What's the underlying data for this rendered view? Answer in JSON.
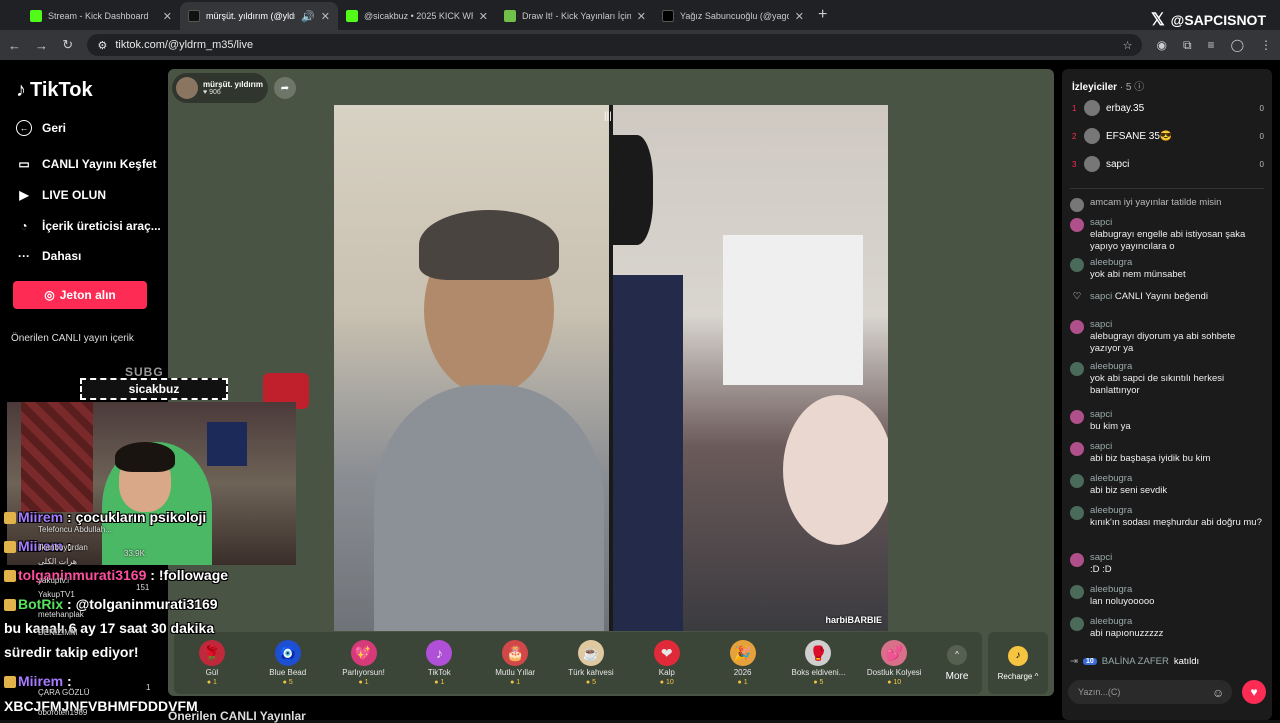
{
  "browser": {
    "tabs": [
      {
        "title": "Stream - Kick Dashboard",
        "fav_color": "#53fc18",
        "active": false
      },
      {
        "title": "mürşüt. yıldırım (@yldrm_m...",
        "fav_color": "#111111",
        "active": true
      },
      {
        "title": "@sicakbuz • 2025 KICK WRAPP...",
        "fav_color": "#53fc18",
        "active": false
      },
      {
        "title": "Draw It! - Kick Yayınları İçin Çizim...",
        "fav_color": "#6fbf4a",
        "active": false
      },
      {
        "title": "Yağız Sabuncuoğlu (@yagosab...",
        "fav_color": "#000000",
        "active": false
      }
    ],
    "new_tab": "+",
    "brand": "@SAPCISNOT",
    "url": "tiktok.com/@yldrm_m35/live"
  },
  "sidebar": {
    "logo": "TikTok",
    "items": [
      {
        "label": "Geri",
        "icon": "←"
      },
      {
        "label": "CANLI Yayını Keşfet",
        "icon": "▭"
      },
      {
        "label": "LIVE OLUN",
        "icon": "▶"
      },
      {
        "label": "İçerik üreticisi araç...",
        "icon": "◔"
      },
      {
        "label": "Dahası",
        "icon": "···"
      }
    ],
    "jeton_button": "Jeton alın",
    "suggested": "Önerilen CANLI yayın içerik"
  },
  "stream": {
    "host_name": "mürşüt. yıldırım",
    "host_likes": "906",
    "video_label": "harbiBARBIE",
    "bottom_title": "Önerilen CANLI Yayınlar"
  },
  "gifts": [
    {
      "name": "Gül",
      "cost": "1",
      "icon": "🌹",
      "color": "#c0283c"
    },
    {
      "name": "Blue Bead",
      "cost": "5",
      "icon": "🧿",
      "color": "#1f4fd1"
    },
    {
      "name": "Parlıyorsun!",
      "cost": "1",
      "icon": "💖",
      "color": "#d63a78"
    },
    {
      "name": "TikTok",
      "cost": "1",
      "icon": "♪",
      "color": "#b04fd8"
    },
    {
      "name": "Mutlu Yıllar",
      "cost": "1",
      "icon": "🎂",
      "color": "#d24848"
    },
    {
      "name": "Türk kahvesi",
      "cost": "5",
      "icon": "☕",
      "color": "#e0c9a0"
    },
    {
      "name": "Kalp",
      "cost": "10",
      "icon": "❤",
      "color": "#e02a3a"
    },
    {
      "name": "2026",
      "cost": "1",
      "icon": "🎉",
      "color": "#e6a23a"
    },
    {
      "name": "Boks eldiveni...",
      "cost": "5",
      "icon": "🥊",
      "color": "#cfcfcf"
    },
    {
      "name": "Dostluk Kolyesi",
      "cost": "10",
      "icon": "💕",
      "color": "#d8708a"
    }
  ],
  "gift_more": "More",
  "recharge": "Recharge ^",
  "chat": {
    "viewers_title": "İzleyiciler",
    "viewers_count": "· 5",
    "top_viewers": [
      {
        "rank": "1",
        "name": "erbay.35",
        "score": "0"
      },
      {
        "rank": "2",
        "name": "EFSANE 35😎",
        "score": "0"
      },
      {
        "rank": "3",
        "name": "sapci",
        "score": "0"
      }
    ],
    "messages": [
      {
        "user": "",
        "text": "amcam iyi yayınlar tatilde misin",
        "color": "#777777"
      },
      {
        "user": "sapci",
        "text": "elabugrayı engelle abi istiyosan şaka yapıyo yayıncılara o",
        "color": "#b0508a"
      },
      {
        "user": "aleebugra",
        "text": "yok abi nem münsabet",
        "color": "#4a6a5a"
      },
      {
        "user": "sapci",
        "text": "CANLI Yayını beğendi",
        "color": "#333333"
      },
      {
        "user": "sapci",
        "text": "alebugrayı diyorum ya abi sohbete yazıyor ya",
        "color": "#b0508a"
      },
      {
        "user": "aleebugra",
        "text": "yok abi sapci de sıkıntılı herkesi banlattınyor",
        "color": "#4a6a5a"
      },
      {
        "user": "sapci",
        "text": "bu kim ya",
        "color": "#b0508a"
      },
      {
        "user": "sapci",
        "text": "abi biz başbaşa iyidik bu kim",
        "color": "#b0508a"
      },
      {
        "user": "aleebugra",
        "text": "abi biz seni sevdik",
        "color": "#4a6a5a"
      },
      {
        "user": "aleebugra",
        "text": "kınık'ın sodası meşhurdur abi doğru mu?",
        "color": "#4a6a5a"
      },
      {
        "user": "sapci",
        "text": ":D :D",
        "color": "#b0508a"
      },
      {
        "user": "aleebugra",
        "text": "lan noluyooooo",
        "color": "#4a6a5a"
      },
      {
        "user": "aleebugra",
        "text": "abi napıonuzzzzz",
        "color": "#4a6a5a"
      }
    ],
    "join_level": "10",
    "join_user": "BALİNA ZAFER",
    "join_text": "katıldı",
    "input_placeholder": "Yazın...(C)"
  },
  "overlay": {
    "sub_label": "SUBG",
    "streamer_name": "sicakbuz",
    "chat_lines": [
      {
        "user": "Miirem",
        "text": ": çocukların psikoloji",
        "color": "#a77bff"
      },
      {
        "user": "Miirem",
        "text": ":",
        "color": "#a77bff"
      },
      {
        "user": "tolganinmurati3169",
        "text": ": !followage",
        "color": "#ff4fa0"
      },
      {
        "user": "BotRix",
        "text": ": @tolganinmurati3169",
        "color": "#57e35d"
      },
      {
        "user": "",
        "text": "bu kanalı 6 ay 17 saat 30 dakika",
        "color": "#ffffff"
      },
      {
        "user": "",
        "text": "süredir takip ediyor!",
        "color": "#ffffff"
      },
      {
        "user": "Miirem",
        "text": ":",
        "color": "#a77bff"
      },
      {
        "user": "",
        "text": "XBCJFMJNFVBHMFDDDVFM",
        "color": "#ffffff"
      }
    ],
    "faint_lines": [
      "Telefoncu Abdullah...",
      "ilkanbuyurdan",
      "هرات الکلی",
      "yakuptv.i",
      "YakupTV1",
      "metehanplak",
      "DENİZİMM",
      "ÇARA GÖZLÜ",
      "oboroten1989"
    ],
    "faint_numbers": [
      "33.9K",
      "151",
      "1"
    ]
  }
}
